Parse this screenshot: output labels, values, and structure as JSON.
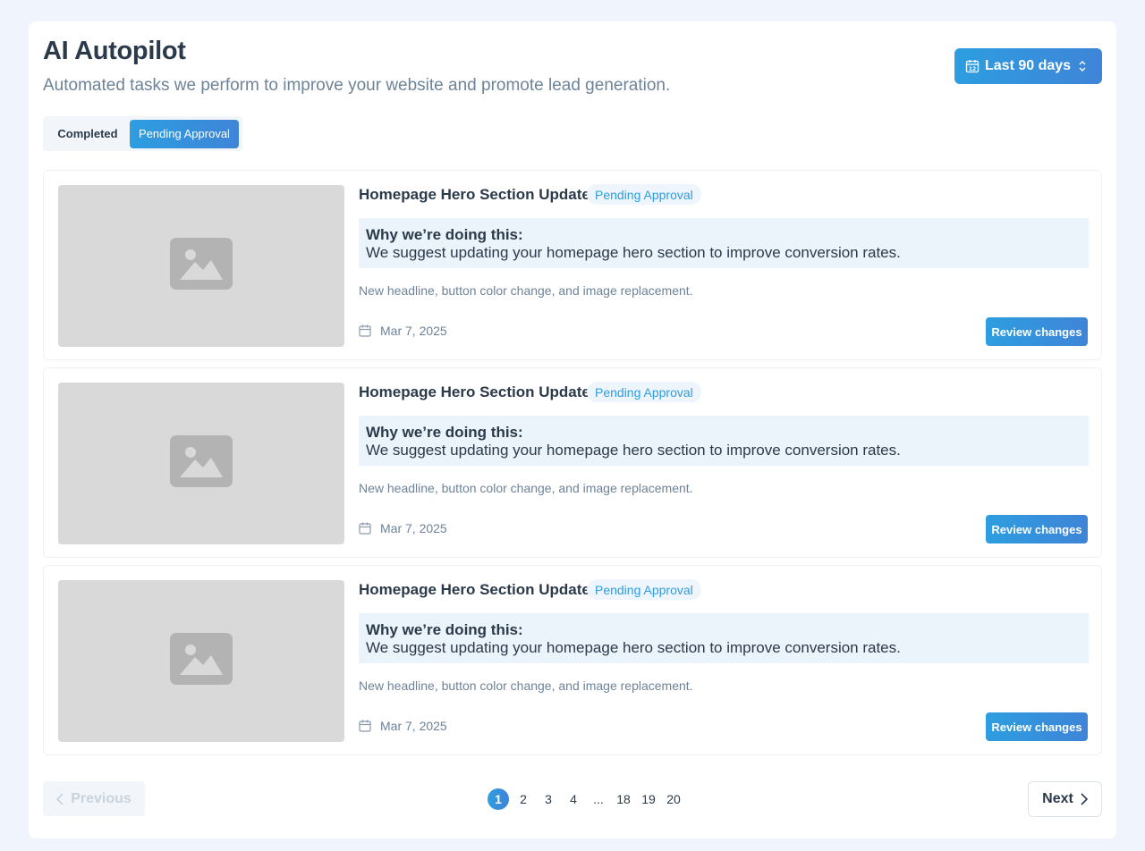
{
  "header": {
    "title": "AI Autopilot",
    "subtitle": "Automated tasks we perform to improve your website and promote lead generation.",
    "date_range": "Last 90 days"
  },
  "tabs": [
    {
      "label": "Completed",
      "active": false
    },
    {
      "label": "Pending Approval",
      "active": true
    }
  ],
  "tasks": [
    {
      "title": "Homepage Hero Section Update",
      "status": "Pending Approval",
      "why_label": "Why we’re doing this:",
      "why_text": "We suggest updating your homepage hero section to improve conversion rates.",
      "description": "New headline, button color change, and image replacement.",
      "date": "Mar 7, 2025",
      "action": "Review changes"
    },
    {
      "title": "Homepage Hero Section Update",
      "status": "Pending Approval",
      "why_label": "Why we’re doing this:",
      "why_text": "We suggest updating your homepage hero section to improve conversion rates.",
      "description": "New headline, button color change, and image replacement.",
      "date": "Mar 7, 2025",
      "action": "Review changes"
    },
    {
      "title": "Homepage Hero Section Update",
      "status": "Pending Approval",
      "why_label": "Why we’re doing this:",
      "why_text": "We suggest updating your homepage hero section to improve conversion rates.",
      "description": "New headline, button color change, and image replacement.",
      "date": "Mar 7, 2025",
      "action": "Review changes"
    }
  ],
  "pagination": {
    "previous": "Previous",
    "next": "Next",
    "pages": [
      "1",
      "2",
      "3",
      "4",
      "...",
      "18",
      "19",
      "20"
    ],
    "current": "1"
  },
  "colors": {
    "accent": "#2d9ee0",
    "accent_end": "#3f84d8",
    "background": "#f0f5fd",
    "placeholder": "#d9d9d9"
  },
  "icons": [
    "calendar-icon",
    "sort-icon",
    "image-placeholder-icon",
    "chevron-left-icon",
    "chevron-right-icon"
  ]
}
